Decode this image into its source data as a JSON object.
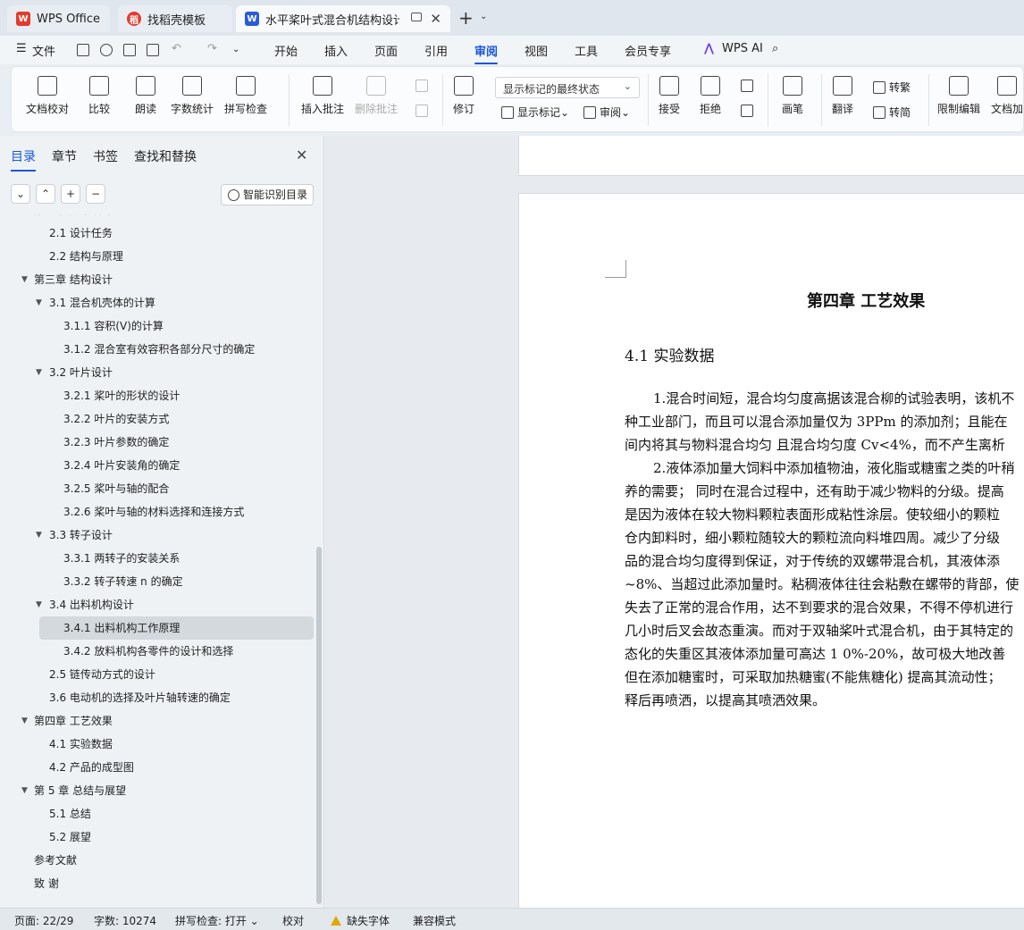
{
  "tabs": [
    {
      "label": "WPS Office",
      "icon": "wps-logo-icon",
      "color": "#e33c2c"
    },
    {
      "label": "找稻壳模板",
      "icon": "docer-icon",
      "color": "#e33c2c"
    },
    {
      "label": "水平桨叶式混合机结构设计 说",
      "icon": "word-doc-icon",
      "color": "#2b5bd7"
    }
  ],
  "menu": {
    "file": "文件",
    "items": [
      "开始",
      "插入",
      "页面",
      "引用",
      "审阅",
      "视图",
      "工具",
      "会员专享"
    ],
    "active": "审阅",
    "ai": "WPS AI"
  },
  "ribbon": {
    "doc_check": "文档校对",
    "compare": "比较",
    "read_aloud": "朗读",
    "word_count": "字数统计",
    "spell_check": "拼写检查",
    "insert_comment": "插入批注",
    "delete_comment": "删除批注",
    "track_changes": "修订",
    "markup_select": "显示标记的最终状态",
    "show_markup": "显示标记",
    "review": "审阅",
    "accept": "接受",
    "reject": "拒绝",
    "pen": "画笔",
    "translate": "翻译",
    "to_traditional": "转繁",
    "to_simplified": "转简",
    "restrict_edit": "限制编辑",
    "doc_protect": "文档加"
  },
  "nav": {
    "tabs": [
      "目录",
      "章节",
      "书签",
      "查找和替换"
    ],
    "active": "目录",
    "smart_btn": "智能识别目录",
    "toc": [
      {
        "text": "第二章 方案设计",
        "level": 1,
        "arrow": true
      },
      {
        "text": "2.1 设计任务",
        "level": 2,
        "arrow": false
      },
      {
        "text": "2.2 结构与原理",
        "level": 2,
        "arrow": false
      },
      {
        "text": "第三章 结构设计",
        "level": 1,
        "arrow": true
      },
      {
        "text": "3.1 混合机壳体的计算",
        "level": 2,
        "arrow": true
      },
      {
        "text": "3.1.1  容积(V)的计算",
        "level": 3,
        "arrow": false
      },
      {
        "text": "3.1.2  混合室有效容积各部分尺寸的确定",
        "level": 3,
        "arrow": false
      },
      {
        "text": "3.2 叶片设计",
        "level": 2,
        "arrow": true
      },
      {
        "text": "3.2.1 桨叶的形状的设计",
        "level": 3,
        "arrow": false
      },
      {
        "text": "3.2.2  叶片的安装方式",
        "level": 3,
        "arrow": false
      },
      {
        "text": "3.2.3  叶片参数的确定",
        "level": 3,
        "arrow": false
      },
      {
        "text": "3.2.4  叶片安装角的确定",
        "level": 3,
        "arrow": false
      },
      {
        "text": "3.2.5  桨叶与轴的配合",
        "level": 3,
        "arrow": false
      },
      {
        "text": "3.2.6 桨叶与轴的材料选择和连接方式",
        "level": 3,
        "arrow": false
      },
      {
        "text": "3.3  转子设计",
        "level": 2,
        "arrow": true
      },
      {
        "text": "3.3.1  两转子的安装关系",
        "level": 3,
        "arrow": false
      },
      {
        "text": "3.3.2  转子转速 n 的确定",
        "level": 3,
        "arrow": false
      },
      {
        "text": "3.4  出料机构设计",
        "level": 2,
        "arrow": true
      },
      {
        "text": "3.4.1 出料机构工作原理",
        "level": 3,
        "arrow": false,
        "selected": true
      },
      {
        "text": "3.4.2  放料机构各零件的设计和选择",
        "level": 3,
        "arrow": false
      },
      {
        "text": "2.5 链传动方式的设计",
        "level": 2,
        "arrow": false
      },
      {
        "text": "3.6 电动机的选择及叶片轴转速的确定",
        "level": 2,
        "arrow": false
      },
      {
        "text": "第四章  工艺效果",
        "level": 1,
        "arrow": true
      },
      {
        "text": "4.1 实验数据",
        "level": 2,
        "arrow": false
      },
      {
        "text": "4.2 产品的成型图",
        "level": 2,
        "arrow": false
      },
      {
        "text": "第 5 章  总结与展望",
        "level": 1,
        "arrow": true
      },
      {
        "text": "5.1  总结",
        "level": 2,
        "arrow": false
      },
      {
        "text": "5.2  展望",
        "level": 2,
        "arrow": false
      },
      {
        "text": "参考文献",
        "level": 1,
        "arrow": false
      },
      {
        "text": "致   谢",
        "level": 1,
        "arrow": false
      }
    ]
  },
  "doc": {
    "chapter_title": "第四章  工艺效果",
    "section_title": "4.1 实验数据",
    "lines": [
      "1.混合时间短，混合均匀度高据该混合柳的试验表明，该机不",
      "种工业部门，而且可以混合添加量仅为 3PPm 的添加剂；且能在",
      "间内将其与物料混合均匀  且混合均匀度 Cv<4%，而不产生离析",
      "2.液体添加量大饲料中添加植物油，液化脂或糖蜜之类的叶稍",
      "养的需要；  同时在混合过程中，还有助于减少物料的分级。提高",
      "是因为液体在较大物料颗粒表面形成粘性涂层。使较细小的颗粒",
      "仓内卸料时，细小颗粒随较大的颗粒流向料堆四周。减少了分级",
      "品的混合均匀度得到保证，对于传统的双螺带混合机，其液体添",
      "~8%、当超过此添加量时。粘稠液体往往会粘敷在螺带的背部，使",
      "失去了正常的混合作用，达不到要求的混合效果，不得不停机进行",
      "几小时后叉会故态重演。而对于双轴桨叶式混合机，由于其特定的",
      "态化的失重区其液体添加量可高达 1 0%-20%，故可极大地改善",
      "但在添加糖蜜时，可采取加热糖蜜(不能焦糖化)  提高其流动性；",
      "释后再喷洒，以提高其喷洒效果。"
    ]
  },
  "status": {
    "page": "页面: 22/29",
    "words": "字数: 10274",
    "spell": "拼写检查: 打开",
    "proof": "校对",
    "missing_font": "缺失字体",
    "compat": "兼容模式"
  }
}
